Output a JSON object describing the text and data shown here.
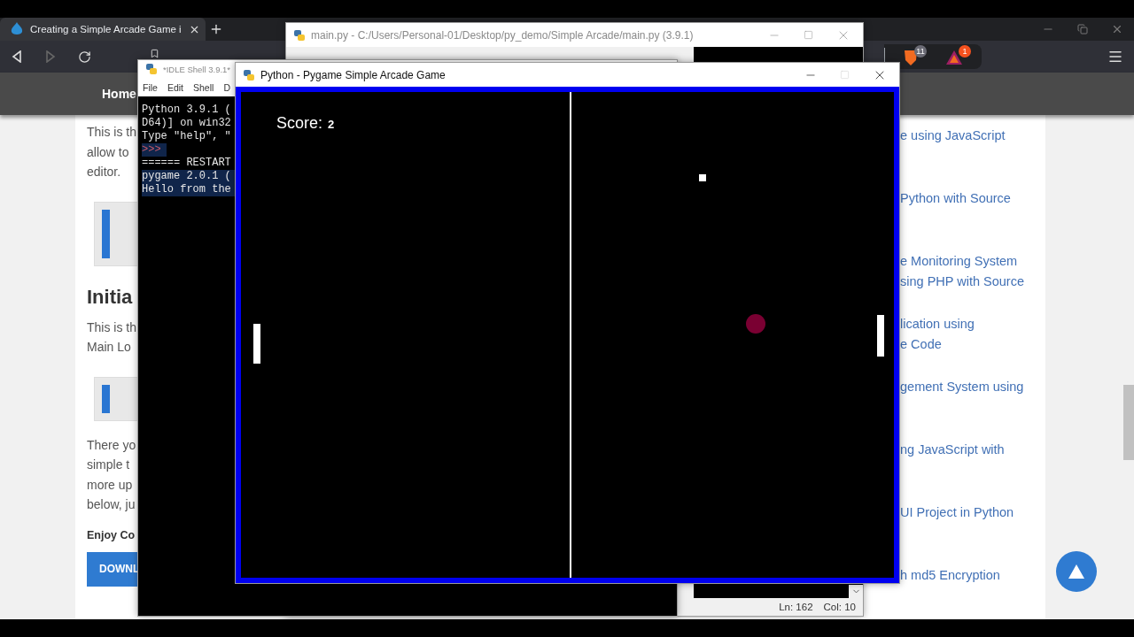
{
  "browser": {
    "tab": {
      "title": "Creating a Simple Arcade Game i",
      "selected": true
    },
    "badges": [
      {
        "kind": "shield",
        "count": "11"
      },
      {
        "kind": "triangle",
        "count": "1"
      }
    ],
    "nav": [
      "Home"
    ],
    "article": [
      {
        "kind": "text",
        "lines": [
          "This is th",
          "allow to",
          "editor."
        ]
      },
      {
        "kind": "code"
      },
      {
        "kind": "heading",
        "lines": [
          "Initia"
        ]
      },
      {
        "kind": "text",
        "lines": [
          "This is th",
          "Main Lo"
        ]
      },
      {
        "kind": "code"
      },
      {
        "kind": "text",
        "lines": [
          "There yo",
          "simple t",
          "more up",
          "below, ju"
        ]
      },
      {
        "kind": "strong",
        "lines": [
          "Enjoy Co"
        ]
      },
      {
        "kind": "button",
        "lines": [
          "DOWNL"
        ]
      }
    ],
    "sidebar_links": [
      [
        "e using JavaScript"
      ],
      [
        "Python with Source"
      ],
      [
        "e Monitoring System",
        "sing PHP with Source"
      ],
      [
        "lication using",
        "e Code"
      ],
      [
        "gement System using"
      ],
      [
        "ng JavaScript with"
      ],
      [
        "UI Project in Python"
      ],
      [
        "h md5 Encryption"
      ]
    ]
  },
  "editor": {
    "title": "main.py - C:/Users/Personal-01/Desktop/py_demo/Simple Arcade/main.py (3.9.1)",
    "status": [
      "Ln: 162",
      "Col: 10"
    ]
  },
  "shell": {
    "title": "*IDLE Shell 3.9.1*",
    "menu": [
      "File",
      "Edit",
      "Shell",
      "D"
    ],
    "lines": [
      {
        "kind": "output",
        "text": "Python 3.9.1 (",
        "selected": false
      },
      {
        "kind": "output",
        "text": "D64)] on win32",
        "selected": false
      },
      {
        "kind": "output",
        "text": "Type \"help\", \"",
        "selected": false
      },
      {
        "kind": "prompt",
        "text": ">>>",
        "selected": true
      },
      {
        "kind": "output",
        "text": "====== RESTART",
        "selected": false
      },
      {
        "kind": "output",
        "text": "pygame 2.0.1 (",
        "selected": true
      },
      {
        "kind": "output",
        "text": "Hello from the",
        "selected": true
      }
    ]
  },
  "game": {
    "title": "Python - Pygame Simple Arcade Game",
    "controls": [
      {
        "kind": "minimize",
        "disabled": false
      },
      {
        "kind": "maximize",
        "disabled": true
      },
      {
        "kind": "close",
        "disabled": false
      }
    ],
    "score_label": "Score:",
    "score": "2"
  }
}
